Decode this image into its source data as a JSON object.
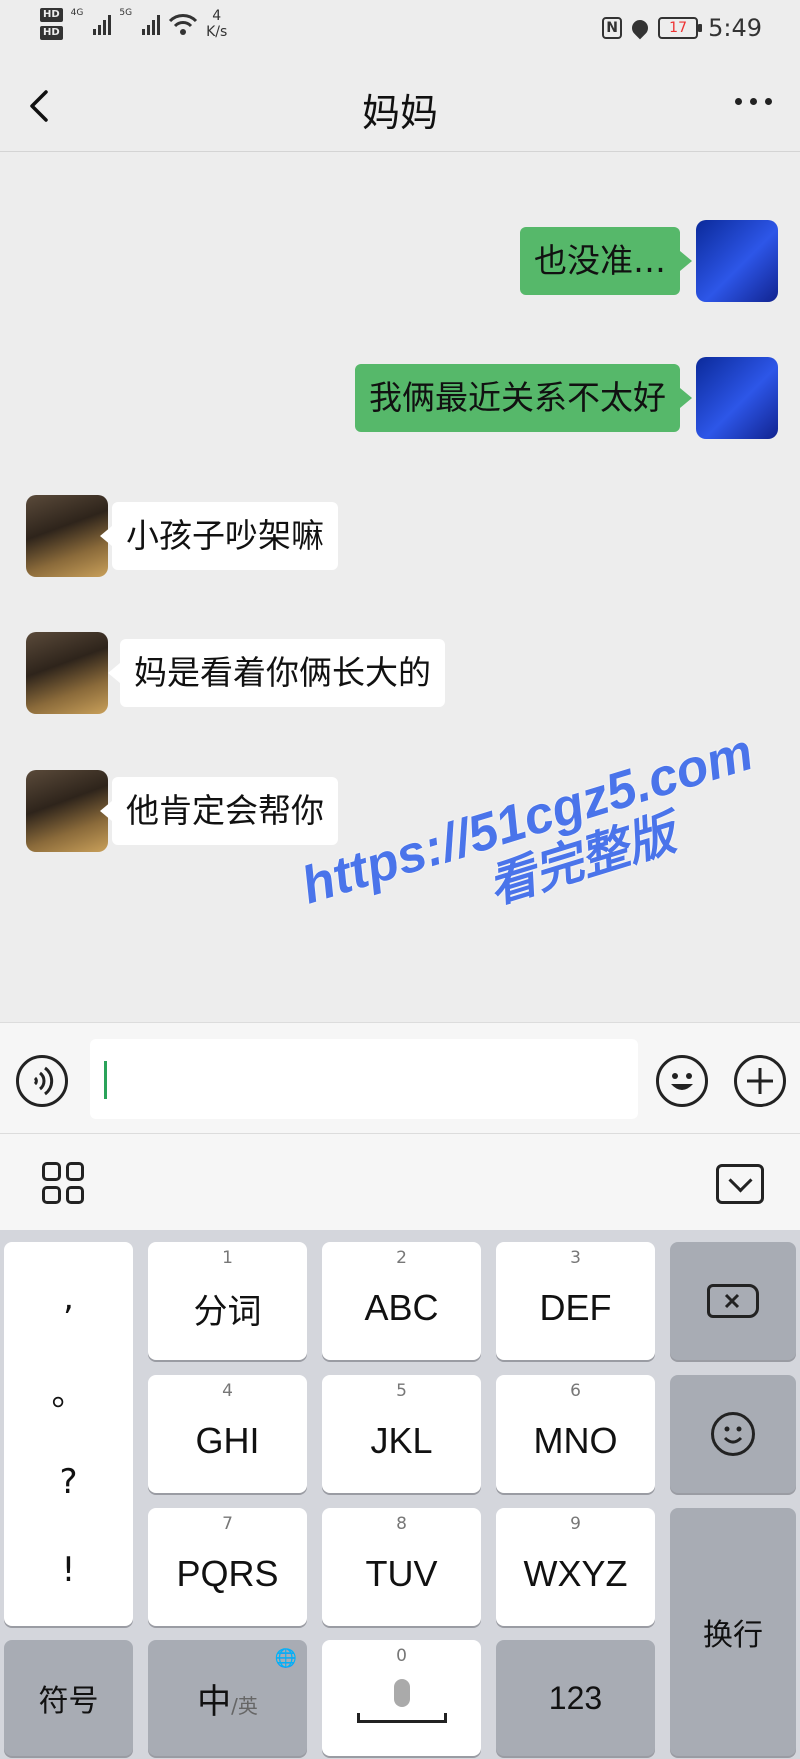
{
  "status_bar": {
    "speed_value": "4",
    "speed_unit": "K/s",
    "network_1": "4G",
    "network_2": "5G",
    "hd_1": "HD",
    "hd_2": "HD",
    "nfc_label": "N",
    "battery_level": "17",
    "time": "5:49"
  },
  "navbar": {
    "title": "妈妈"
  },
  "messages": [
    {
      "side": "right",
      "text": "也没准…"
    },
    {
      "side": "right",
      "text": "我俩最近关系不太好"
    },
    {
      "side": "left",
      "text": "小孩子吵架嘛"
    },
    {
      "side": "left",
      "text": "妈是看着你俩长大的"
    },
    {
      "side": "left",
      "text": "他肯定会帮你"
    }
  ],
  "watermark": {
    "line1": "https://51cgz5.com",
    "line2": "看完整版"
  },
  "input": {
    "value": ""
  },
  "keyboard": {
    "punct": [
      ",",
      "。",
      "?",
      "!"
    ],
    "row1": [
      {
        "num": "1",
        "label": "分词"
      },
      {
        "num": "2",
        "label": "ABC"
      },
      {
        "num": "3",
        "label": "DEF"
      }
    ],
    "row2": [
      {
        "num": "4",
        "label": "GHI"
      },
      {
        "num": "5",
        "label": "JKL"
      },
      {
        "num": "6",
        "label": "MNO"
      }
    ],
    "row3": [
      {
        "num": "7",
        "label": "PQRS"
      },
      {
        "num": "8",
        "label": "TUV"
      },
      {
        "num": "9",
        "label": "WXYZ"
      }
    ],
    "symbols_label": "符号",
    "lang_main": "中",
    "lang_alt": "/英",
    "space_num": "0",
    "numbers_label": "123",
    "enter_label": "换行"
  },
  "colors": {
    "sent_bubble": "#56b86a",
    "received_bubble": "#ffffff",
    "watermark": "#4a74ea",
    "caret": "#2aa35a"
  }
}
